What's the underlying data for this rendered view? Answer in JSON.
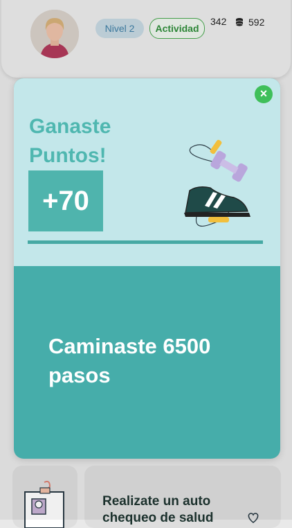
{
  "header": {
    "level_label": "Nivel 2",
    "activity_label": "Actividad",
    "stat_1": "342",
    "stat_2": "592"
  },
  "background_cards": {
    "checkup_title": "Realizate un auto chequeo de salud"
  },
  "modal": {
    "close_label": "×",
    "title": "Ganaste Puntos!",
    "points": "+70",
    "progress_fraction": 1.0,
    "message": "Caminaste 6500 pasos"
  },
  "colors": {
    "modal_top_bg": "#c3e7ea",
    "modal_bottom_bg": "#46adaa",
    "accent_teal": "#4fb4ad",
    "close_green": "#3fbf5a"
  },
  "icons": [
    "coins-icon",
    "close-icon",
    "heart-icon",
    "sneaker-dumbbell-illustration",
    "id-card-illustration"
  ]
}
